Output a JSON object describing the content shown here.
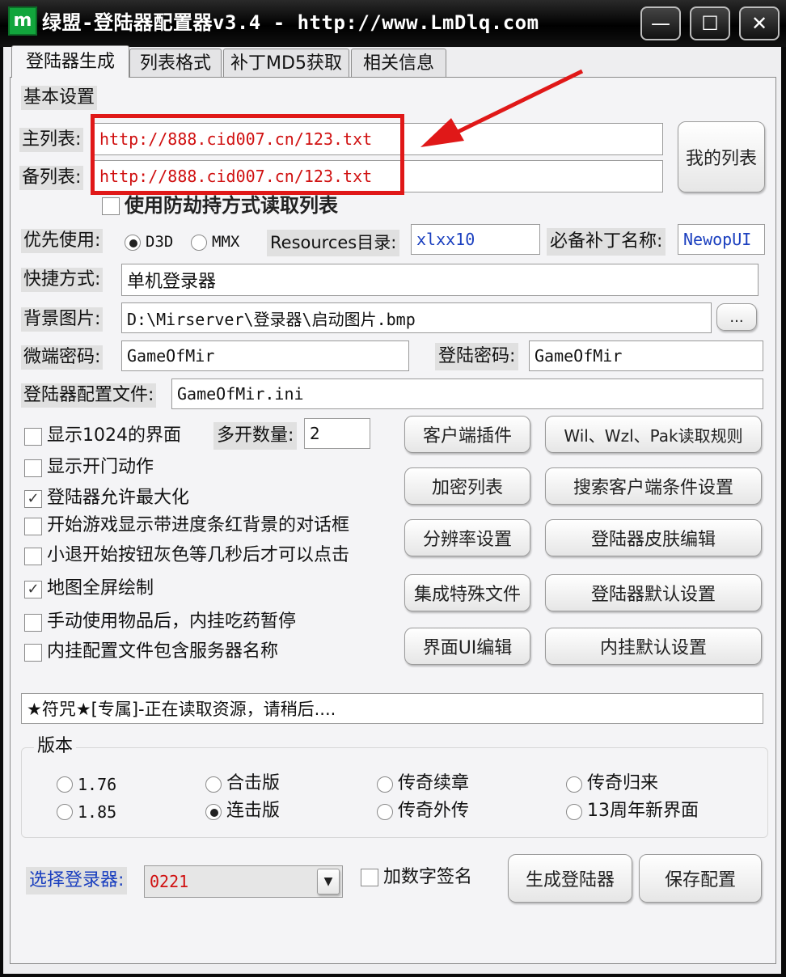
{
  "window": {
    "title": "绿盟-登陆器配置器v3.4 - http://www.LmDlq.com",
    "logo": "m",
    "minimize_glyph": "—",
    "maximize_glyph": "☐",
    "close_glyph": "✕"
  },
  "tabs": [
    "登陆器生成",
    "列表格式",
    "补丁MD5获取",
    "相关信息"
  ],
  "basic": {
    "section_label": "基本设置",
    "main_list_label": "主列表:",
    "main_list_value": "http://888.cid007.cn/123.txt",
    "backup_list_label": "备列表:",
    "backup_list_value": "http://888.cid007.cn/123.txt",
    "my_list_button": "我的列表",
    "anti_hijack_label": "使用防劫持方式读取列表",
    "priority_label": "优先使用:",
    "d3d_label": "D3D",
    "mmx_label": "MMX",
    "resources_label": "Resources目录:",
    "resources_value": "xlxx10",
    "patch_name_label": "必备补丁名称:",
    "patch_name_value": "NewopUI",
    "shortcut_label": "快捷方式:",
    "shortcut_value": "单机登录器",
    "bg_image_label": "背景图片:",
    "bg_image_value": "D:\\Mirserver\\登录器\\启动图片.bmp",
    "browse_button": "...",
    "micro_pwd_label": "微端密码:",
    "micro_pwd_value": "GameOfMir",
    "login_pwd_label": "登陆密码:",
    "login_pwd_value": "GameOfMir",
    "config_file_label": "登陆器配置文件:",
    "config_file_value": "GameOfMir.ini"
  },
  "options": [
    {
      "label": "显示1024的界面",
      "checked": false
    },
    {
      "label": "显示开门动作",
      "checked": false
    },
    {
      "label": "登陆器允许最大化",
      "checked": true
    },
    {
      "label": "开始游戏显示带进度条红背景的对话框",
      "checked": false
    },
    {
      "label": "小退开始按钮灰色等几秒后才可以点击",
      "checked": false
    },
    {
      "label": "地图全屏绘制",
      "checked": true
    },
    {
      "label": "手动使用物品后，内挂吃药暂停",
      "checked": false
    },
    {
      "label": "内挂配置文件包含服务器名称",
      "checked": false
    }
  ],
  "multi_open": {
    "label": "多开数量:",
    "value": "2"
  },
  "buttons": {
    "client_plugin": "客户端插件",
    "wil_rules": "Wil、Wzl、Pak读取规则",
    "encrypt_list": "加密列表",
    "search_client": "搜索客户端条件设置",
    "resolution": "分辨率设置",
    "skin_edit": "登陆器皮肤编辑",
    "special_files": "集成特殊文件",
    "default_settings": "登陆器默认设置",
    "ui_edit": "界面UI编辑",
    "plugin_defaults": "内挂默认设置"
  },
  "status_text": "★符咒★[专属]-正在读取资源，请稍后....",
  "version": {
    "group_label": "版本",
    "items": [
      {
        "label": "1.76",
        "selected": false
      },
      {
        "label": "合击版",
        "selected": false
      },
      {
        "label": "传奇续章",
        "selected": false
      },
      {
        "label": "传奇归来",
        "selected": false
      },
      {
        "label": "1.85",
        "selected": false
      },
      {
        "label": "连击版",
        "selected": true
      },
      {
        "label": "传奇外传",
        "selected": false
      },
      {
        "label": "13周年新界面",
        "selected": false
      }
    ]
  },
  "bottom": {
    "select_label": "选择登录器:",
    "select_value": "0221",
    "digital_sign_label": "加数字签名",
    "generate_button": "生成登陆器",
    "save_button": "保存配置"
  },
  "colors": {
    "highlight_box": "#e01818",
    "arrow": "#e01818",
    "link_text": "#d01010",
    "label_blue": "#1a3fbf"
  }
}
